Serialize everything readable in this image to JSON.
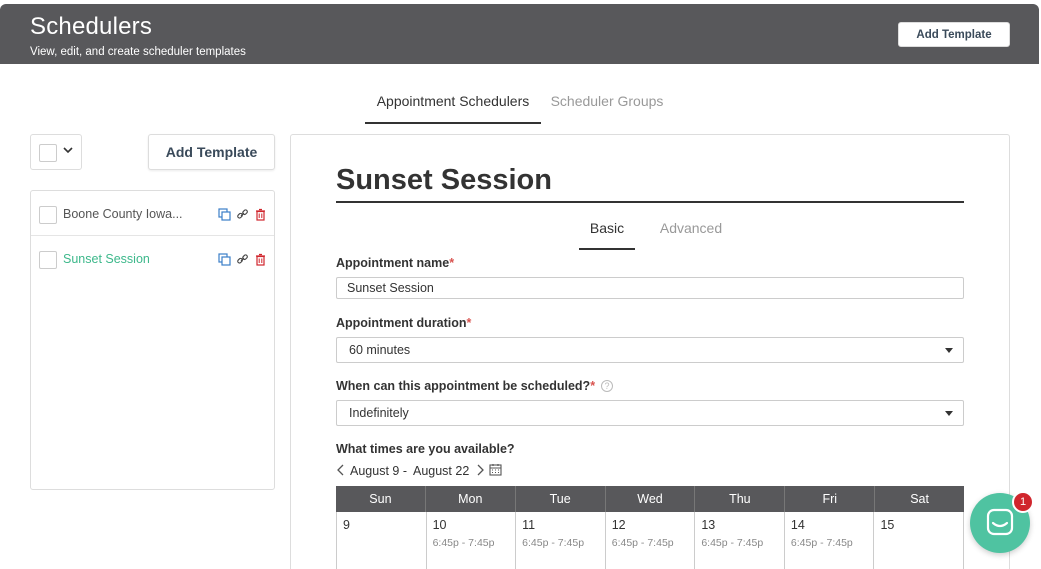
{
  "header": {
    "title": "Schedulers",
    "subtitle": "View, edit, and create scheduler templates",
    "add_button": "Add Template"
  },
  "top_tabs": [
    {
      "label": "Appointment Schedulers",
      "active": true
    },
    {
      "label": "Scheduler Groups",
      "active": false
    }
  ],
  "sidebar": {
    "add_button": "Add Template",
    "items": [
      {
        "label": "Boone County Iowa...",
        "active": false
      },
      {
        "label": "Sunset Session",
        "active": true
      }
    ]
  },
  "editor": {
    "title": "Sunset Session",
    "tabs": [
      {
        "label": "Basic",
        "active": true
      },
      {
        "label": "Advanced",
        "active": false
      }
    ],
    "name_label": "Appointment name",
    "name_value": "Sunset Session",
    "duration_label": "Appointment duration",
    "duration_value": "60 minutes",
    "when_label": "When can this appointment be scheduled?",
    "when_value": "Indefinitely",
    "times_label": "What times are you available?",
    "range_start": "August 9 -",
    "range_end": "August 22",
    "calendar": {
      "days": [
        "Sun",
        "Mon",
        "Tue",
        "Wed",
        "Thu",
        "Fri",
        "Sat"
      ],
      "dates": [
        "9",
        "10",
        "11",
        "12",
        "13",
        "14",
        "15"
      ],
      "times": [
        "",
        "6:45p - 7:45p",
        "6:45p - 7:45p",
        "6:45p - 7:45p",
        "6:45p - 7:45p",
        "6:45p - 7:45p",
        ""
      ]
    }
  },
  "chat": {
    "badge": "1"
  },
  "colors": {
    "header_bg": "#58585b",
    "accent_green": "#3db88b",
    "chat_bg": "#4fc3a1",
    "required": "#d9534f",
    "badge": "#d0262d"
  }
}
